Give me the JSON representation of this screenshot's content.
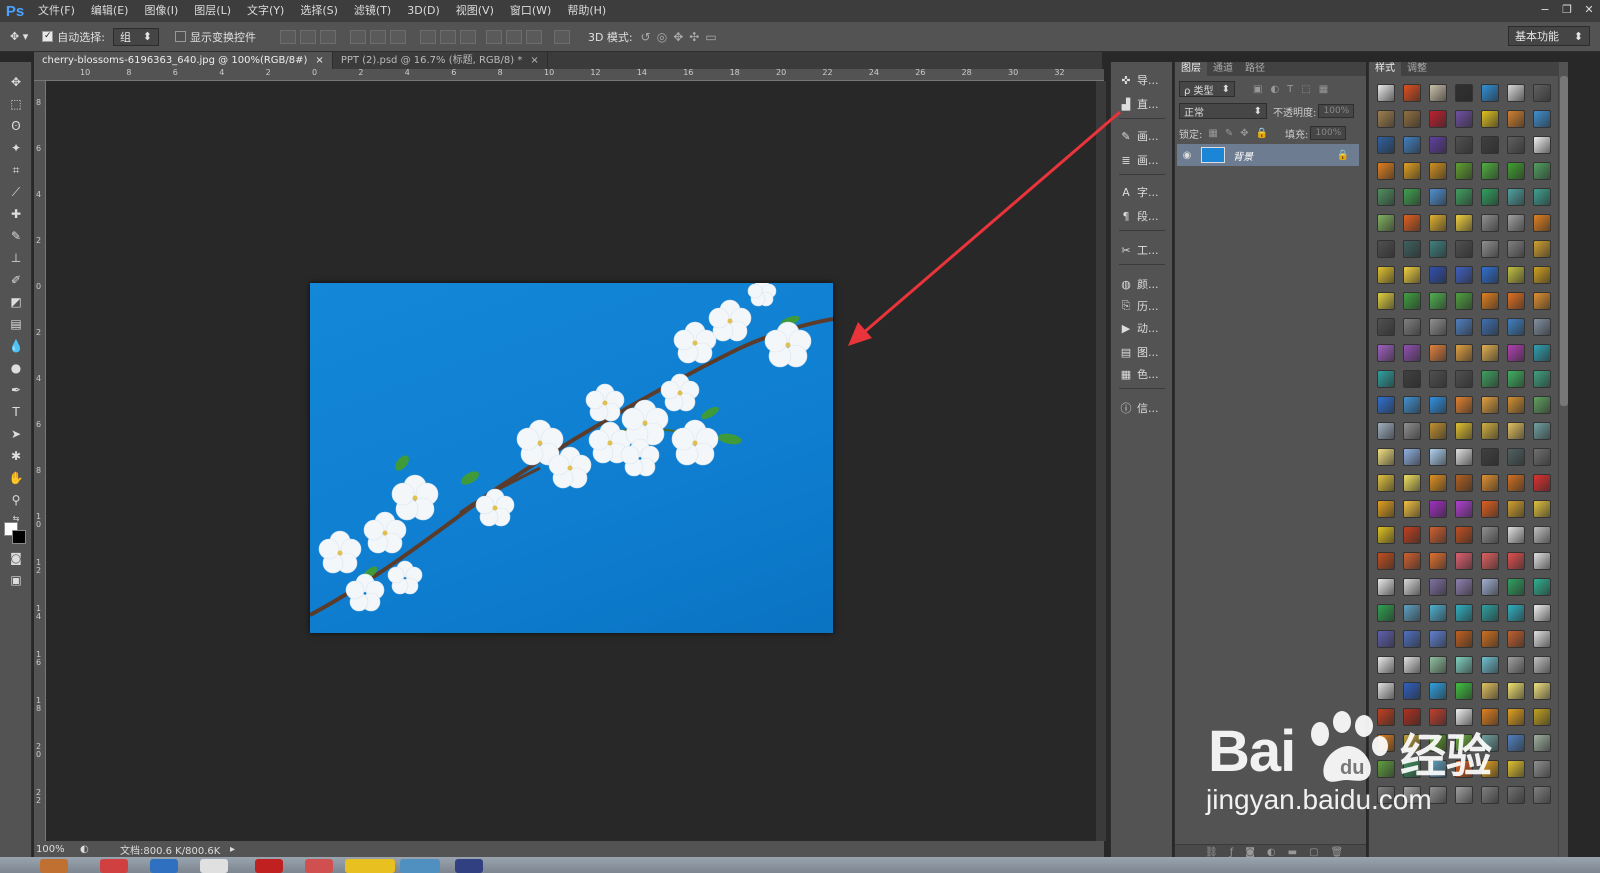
{
  "app": {
    "logo": "Ps"
  },
  "menu": [
    "文件(F)",
    "编辑(E)",
    "图像(I)",
    "图层(L)",
    "文字(Y)",
    "选择(S)",
    "滤镜(T)",
    "3D(D)",
    "视图(V)",
    "窗口(W)",
    "帮助(H)"
  ],
  "window_controls": [
    "−",
    "❐",
    "✕"
  ],
  "options": {
    "auto_select_label": "自动选择:",
    "auto_select_value": "组",
    "show_transform_label": "显示变换控件",
    "mode_3d_label": "3D 模式:",
    "workspace": "基本功能"
  },
  "tabs": [
    {
      "label": "cherry-blossoms-6196363_640.jpg @ 100%(RGB/8#)",
      "close": "×"
    },
    {
      "label": "PPT (2).psd @ 16.7% (标题, RGB/8) *",
      "close": "×"
    }
  ],
  "ruler_top": [
    "10",
    "8",
    "6",
    "4",
    "2",
    "0",
    "2",
    "4",
    "6",
    "8",
    "10",
    "12",
    "14",
    "16",
    "18",
    "20",
    "22",
    "24",
    "26",
    "28",
    "30",
    "32"
  ],
  "ruler_left": [
    "8",
    "6",
    "4",
    "2",
    "0",
    "2",
    "4",
    "6",
    "8",
    "1\n0",
    "1\n2",
    "1\n4",
    "1\n6",
    "1\n8",
    "2\n0",
    "2\n2"
  ],
  "status": {
    "zoom": "100%",
    "doc": "文档:800.6 K/800.6K"
  },
  "dock": [
    {
      "icon": "navigator-icon",
      "glyph": "✜",
      "label": "导..."
    },
    {
      "icon": "histogram-icon",
      "glyph": "▟",
      "label": "直..."
    },
    {
      "icon": "brush-icon",
      "glyph": "✎",
      "label": "画..."
    },
    {
      "icon": "brush-preset-icon",
      "glyph": "≣",
      "label": "画..."
    },
    {
      "icon": "character-icon",
      "glyph": "A",
      "label": "字..."
    },
    {
      "icon": "paragraph-icon",
      "glyph": "¶",
      "label": "段..."
    },
    {
      "icon": "tool-presets-icon",
      "glyph": "✂",
      "label": "工..."
    },
    {
      "icon": "swatches-icon",
      "glyph": "◍",
      "label": "颜..."
    },
    {
      "icon": "history-icon",
      "glyph": "⎘",
      "label": "历..."
    },
    {
      "icon": "actions-icon",
      "glyph": "▶",
      "label": "动..."
    },
    {
      "icon": "layer-comps-icon",
      "glyph": "▤",
      "label": "图..."
    },
    {
      "icon": "color-icon",
      "glyph": "▦",
      "label": "色..."
    },
    {
      "icon": "info-icon",
      "glyph": "ⓘ",
      "label": "信..."
    }
  ],
  "layers_panel": {
    "tabs": [
      "图层",
      "通道",
      "路径"
    ],
    "filter": "ρ 类型",
    "blend": "正常",
    "opacity_label": "不透明度:",
    "opacity_value": "100%",
    "lock_label": "锁定:",
    "fill_label": "填充:",
    "fill_value": "100%",
    "layer_name": "背景"
  },
  "styles_panel": {
    "tabs": [
      "样式",
      "调整"
    ]
  },
  "watermark": {
    "brand": "Bai",
    "brand2": "经验",
    "url": "jingyan.baidu.com"
  },
  "colors": {
    "accent_blue": "#4aa3ff",
    "arrow": "#e8343a",
    "photo_sky": "#1487d8"
  }
}
